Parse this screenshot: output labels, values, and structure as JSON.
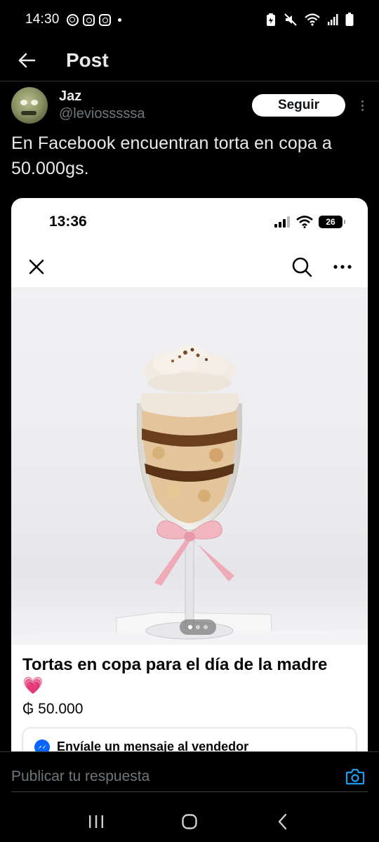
{
  "status_bar": {
    "time": "14:30",
    "left_icons": [
      "signal-ring-icon",
      "instagram-icon",
      "instagram-icon",
      "notification-dot-icon"
    ],
    "right_icons": [
      "battery-saver-icon",
      "mute-icon",
      "wifi-icon",
      "cell-signal-icon",
      "battery-icon"
    ]
  },
  "header": {
    "title": "Post",
    "back_icon": "arrow-left-icon"
  },
  "tweet": {
    "author_name": "Jaz",
    "author_handle": "@leviosssssa",
    "follow_label": "Seguir",
    "text": "En Facebook encuentran torta en copa a 50.000gs."
  },
  "embedded_screenshot": {
    "status_time": "13:36",
    "battery_level": "26",
    "toolbar_icons": [
      "close-icon",
      "search-icon",
      "more-horizontal-icon"
    ],
    "carousel": {
      "count": 3,
      "active_index": 0
    },
    "product_title": "Tortas en copa para el día de la madre",
    "product_emoji": "💗",
    "product_price": "₲ 50.000",
    "seller_message": "Envíale un mensaje al vendedor"
  },
  "reply": {
    "placeholder": "Publicar tu respuesta",
    "camera_icon": "camera-icon"
  },
  "nav_bar": {
    "buttons": [
      "recents-icon",
      "home-icon",
      "back-icon"
    ]
  },
  "colors": {
    "background": "#000000",
    "text_primary": "#e7e9ea",
    "text_secondary": "#71767b",
    "accent": "#1d9bf0",
    "follow_button_bg": "#ffffff",
    "messenger_blue": "#0866ff"
  }
}
